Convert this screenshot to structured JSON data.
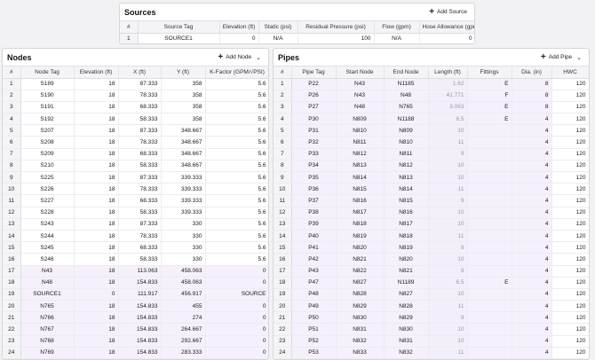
{
  "sources": {
    "title": "Sources",
    "add_label": "Add Source",
    "columns": [
      "#",
      "Source Tag",
      "Elevation (ft)",
      "Static (psi)",
      "Residual Pressure (psi)",
      "Flow (gpm)",
      "Hose Allowance (gpm)"
    ],
    "rows": [
      [
        "1",
        "SOURCE1",
        "0",
        "N/A",
        "100",
        "N/A",
        "0"
      ]
    ]
  },
  "nodes": {
    "title": "Nodes",
    "add_label": "Add Node",
    "columns": [
      "#",
      "Node Tag",
      "Elevation (ft)",
      "X (ft)",
      "Y (ft)",
      "K-Factor (GPM/√PSI)"
    ],
    "rows": [
      [
        "1",
        "S189",
        "18",
        "87.333",
        "358",
        "5.6"
      ],
      [
        "2",
        "S190",
        "18",
        "78.333",
        "358",
        "5.6"
      ],
      [
        "3",
        "S191",
        "18",
        "68.333",
        "358",
        "5.6"
      ],
      [
        "4",
        "S192",
        "18",
        "58.333",
        "358",
        "5.6"
      ],
      [
        "5",
        "S207",
        "18",
        "87.333",
        "348.667",
        "5.6"
      ],
      [
        "6",
        "S208",
        "18",
        "78.333",
        "348.667",
        "5.6"
      ],
      [
        "7",
        "S209",
        "18",
        "68.333",
        "348.667",
        "5.6"
      ],
      [
        "8",
        "S210",
        "18",
        "58.333",
        "348.667",
        "5.6"
      ],
      [
        "9",
        "S225",
        "18",
        "87.333",
        "339.333",
        "5.6"
      ],
      [
        "10",
        "S226",
        "18",
        "78.333",
        "339.333",
        "5.6"
      ],
      [
        "11",
        "S227",
        "18",
        "68.333",
        "339.333",
        "5.6"
      ],
      [
        "12",
        "S228",
        "18",
        "58.333",
        "339.333",
        "5.6"
      ],
      [
        "13",
        "S243",
        "18",
        "87.333",
        "330",
        "5.6"
      ],
      [
        "14",
        "S244",
        "18",
        "78.333",
        "330",
        "5.6"
      ],
      [
        "15",
        "S245",
        "18",
        "68.333",
        "330",
        "5.6"
      ],
      [
        "16",
        "S246",
        "18",
        "58.333",
        "330",
        "5.6"
      ],
      [
        "17",
        "N43",
        "18",
        "113.063",
        "458.063",
        "0"
      ],
      [
        "18",
        "N48",
        "18",
        "154.833",
        "458.063",
        "0"
      ],
      [
        "19",
        "SOURCE1",
        "0",
        "111.917",
        "456.917",
        "SOURCE"
      ],
      [
        "20",
        "N765",
        "18",
        "154.833",
        "455",
        "0"
      ],
      [
        "21",
        "N766",
        "18",
        "154.833",
        "274",
        "0"
      ],
      [
        "22",
        "N767",
        "18",
        "154.833",
        "264.667",
        "0"
      ],
      [
        "23",
        "N768",
        "18",
        "154.833",
        "292.667",
        "0"
      ],
      [
        "24",
        "N769",
        "18",
        "154.833",
        "283.333",
        "0"
      ]
    ]
  },
  "pipes": {
    "title": "Pipes",
    "add_label": "Add Pipe",
    "columns": [
      "#",
      "Pipe Tag",
      "Start Node",
      "End Node",
      "Length (ft)",
      "Fittings",
      "Dia. (in)",
      "HWC"
    ],
    "rows": [
      [
        "1",
        "P22",
        "N43",
        "N1185",
        "1.62",
        "E",
        "8",
        "120"
      ],
      [
        "2",
        "P26",
        "N43",
        "N48",
        "41.771",
        "F",
        "8",
        "120"
      ],
      [
        "3",
        "P27",
        "N48",
        "N765",
        "3.063",
        "E",
        "8",
        "120"
      ],
      [
        "4",
        "P30",
        "N809",
        "N1188",
        "6.5",
        "E",
        "4",
        "120"
      ],
      [
        "5",
        "P31",
        "N810",
        "N809",
        "10",
        "",
        "4",
        "120"
      ],
      [
        "6",
        "P32",
        "N811",
        "N810",
        "11",
        "",
        "4",
        "120"
      ],
      [
        "7",
        "P33",
        "N812",
        "N811",
        "9",
        "",
        "4",
        "120"
      ],
      [
        "8",
        "P34",
        "N813",
        "N812",
        "10",
        "",
        "4",
        "120"
      ],
      [
        "9",
        "P35",
        "N814",
        "N813",
        "10",
        "",
        "4",
        "120"
      ],
      [
        "10",
        "P36",
        "N815",
        "N814",
        "11",
        "",
        "4",
        "120"
      ],
      [
        "11",
        "P37",
        "N816",
        "N815",
        "9",
        "",
        "4",
        "120"
      ],
      [
        "12",
        "P38",
        "N817",
        "N816",
        "10",
        "",
        "4",
        "120"
      ],
      [
        "13",
        "P39",
        "N818",
        "N817",
        "10",
        "",
        "4",
        "120"
      ],
      [
        "14",
        "P40",
        "N819",
        "N818",
        "11",
        "",
        "4",
        "120"
      ],
      [
        "15",
        "P41",
        "N820",
        "N819",
        "9",
        "",
        "4",
        "120"
      ],
      [
        "16",
        "P42",
        "N821",
        "N820",
        "10",
        "",
        "4",
        "120"
      ],
      [
        "17",
        "P43",
        "N822",
        "N821",
        "8",
        "",
        "4",
        "120"
      ],
      [
        "18",
        "P47",
        "N827",
        "N1189",
        "6.5",
        "E",
        "4",
        "120"
      ],
      [
        "19",
        "P48",
        "N828",
        "N827",
        "10",
        "",
        "4",
        "120"
      ],
      [
        "20",
        "P49",
        "N829",
        "N828",
        "11",
        "",
        "4",
        "120"
      ],
      [
        "21",
        "P50",
        "N830",
        "N829",
        "9",
        "",
        "4",
        "120"
      ],
      [
        "22",
        "P51",
        "N831",
        "N830",
        "10",
        "",
        "4",
        "120"
      ],
      [
        "23",
        "P52",
        "N832",
        "N831",
        "10",
        "",
        "4",
        "120"
      ],
      [
        "24",
        "P53",
        "N833",
        "N832",
        "11",
        "",
        "4",
        "120"
      ]
    ]
  }
}
